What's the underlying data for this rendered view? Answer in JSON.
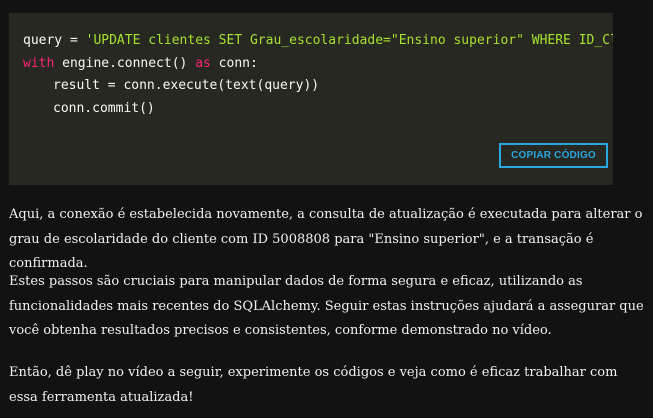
{
  "code": {
    "line1_prefix": "query = ",
    "line1_string": "'UPDATE clientes SET Grau_escolaridade=\"Ensino superior\" WHERE ID_Client",
    "line2_keyword_with": "with",
    "line2_mid": " engine.connect() ",
    "line2_keyword_as": "as",
    "line2_suffix": " conn:",
    "line3": "result = conn.execute(text(query))",
    "line4": "conn.commit()",
    "copy_label": "COPIAR CÓDIGO"
  },
  "paragraphs": [
    "Aqui, a conexão é estabelecida novamente, a consulta de atualização é executada para alterar o grau de escolaridade do cliente com ID 5008808 para \"Ensino superior\", e a transação é confirmada.",
    "Estes passos são cruciais para manipular dados de forma segura e eficaz, utilizando as funcionalidades mais recentes do SQLAlchemy. Seguir estas instruções ajudará a assegurar que você obtenha resultados precisos e consistentes, conforme demonstrado no vídeo.",
    "Então, dê play no vídeo a seguir, experimente os códigos e veja como é eficaz trabalhar com essa ferramenta atualizada!"
  ],
  "colors": {
    "code_background": "#272822",
    "string": "#a6e22e",
    "keyword": "#f92672",
    "button_accent": "#2aa6e0",
    "page_background": "#121212"
  }
}
